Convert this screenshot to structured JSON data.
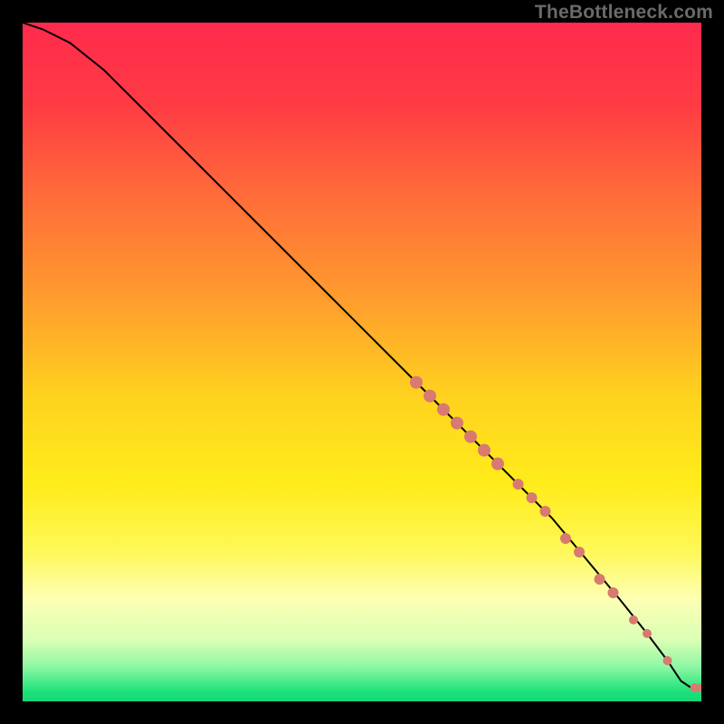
{
  "watermark": "TheBottleneck.com",
  "colors": {
    "black": "#000000",
    "curve": "#000000",
    "marker": "#d87a6f",
    "gradient_stops": [
      {
        "offset": 0.0,
        "color": "#ff2a4d"
      },
      {
        "offset": 0.12,
        "color": "#ff3b44"
      },
      {
        "offset": 0.25,
        "color": "#ff6a3a"
      },
      {
        "offset": 0.4,
        "color": "#ff9a2e"
      },
      {
        "offset": 0.55,
        "color": "#ffd21f"
      },
      {
        "offset": 0.68,
        "color": "#ffec1a"
      },
      {
        "offset": 0.78,
        "color": "#fff85a"
      },
      {
        "offset": 0.85,
        "color": "#fdffb4"
      },
      {
        "offset": 0.91,
        "color": "#d9ffb5"
      },
      {
        "offset": 0.95,
        "color": "#8cf7a3"
      },
      {
        "offset": 0.985,
        "color": "#1de27a"
      },
      {
        "offset": 1.0,
        "color": "#17d677"
      }
    ]
  },
  "chart_data": {
    "type": "line",
    "title": "",
    "xlabel": "",
    "ylabel": "",
    "xlim": [
      0,
      100
    ],
    "ylim": [
      0,
      100
    ],
    "series": [
      {
        "name": "bottleneck-curve",
        "x": [
          0,
          3,
          7,
          12,
          18,
          25,
          35,
          45,
          55,
          62,
          68,
          73,
          78,
          83,
          88,
          92,
          95,
          97,
          98.5,
          100
        ],
        "y": [
          100,
          99,
          97,
          93,
          87,
          80,
          70,
          60,
          50,
          43,
          37,
          32,
          27,
          21,
          15,
          10,
          6,
          3,
          2,
          2
        ]
      }
    ],
    "markers": {
      "name": "highlighted-points",
      "x": [
        58,
        60,
        62,
        64,
        66,
        68,
        70,
        73,
        75,
        77,
        80,
        82,
        85,
        87,
        90,
        92,
        95,
        99,
        100
      ],
      "y": [
        47,
        45,
        43,
        41,
        39,
        37,
        35,
        32,
        30,
        28,
        24,
        22,
        18,
        16,
        12,
        10,
        6,
        2,
        2
      ],
      "radius": [
        7,
        7,
        7,
        7,
        7,
        7,
        7,
        6,
        6,
        6,
        6,
        6,
        6,
        6,
        5,
        5,
        5,
        5,
        5
      ]
    }
  }
}
